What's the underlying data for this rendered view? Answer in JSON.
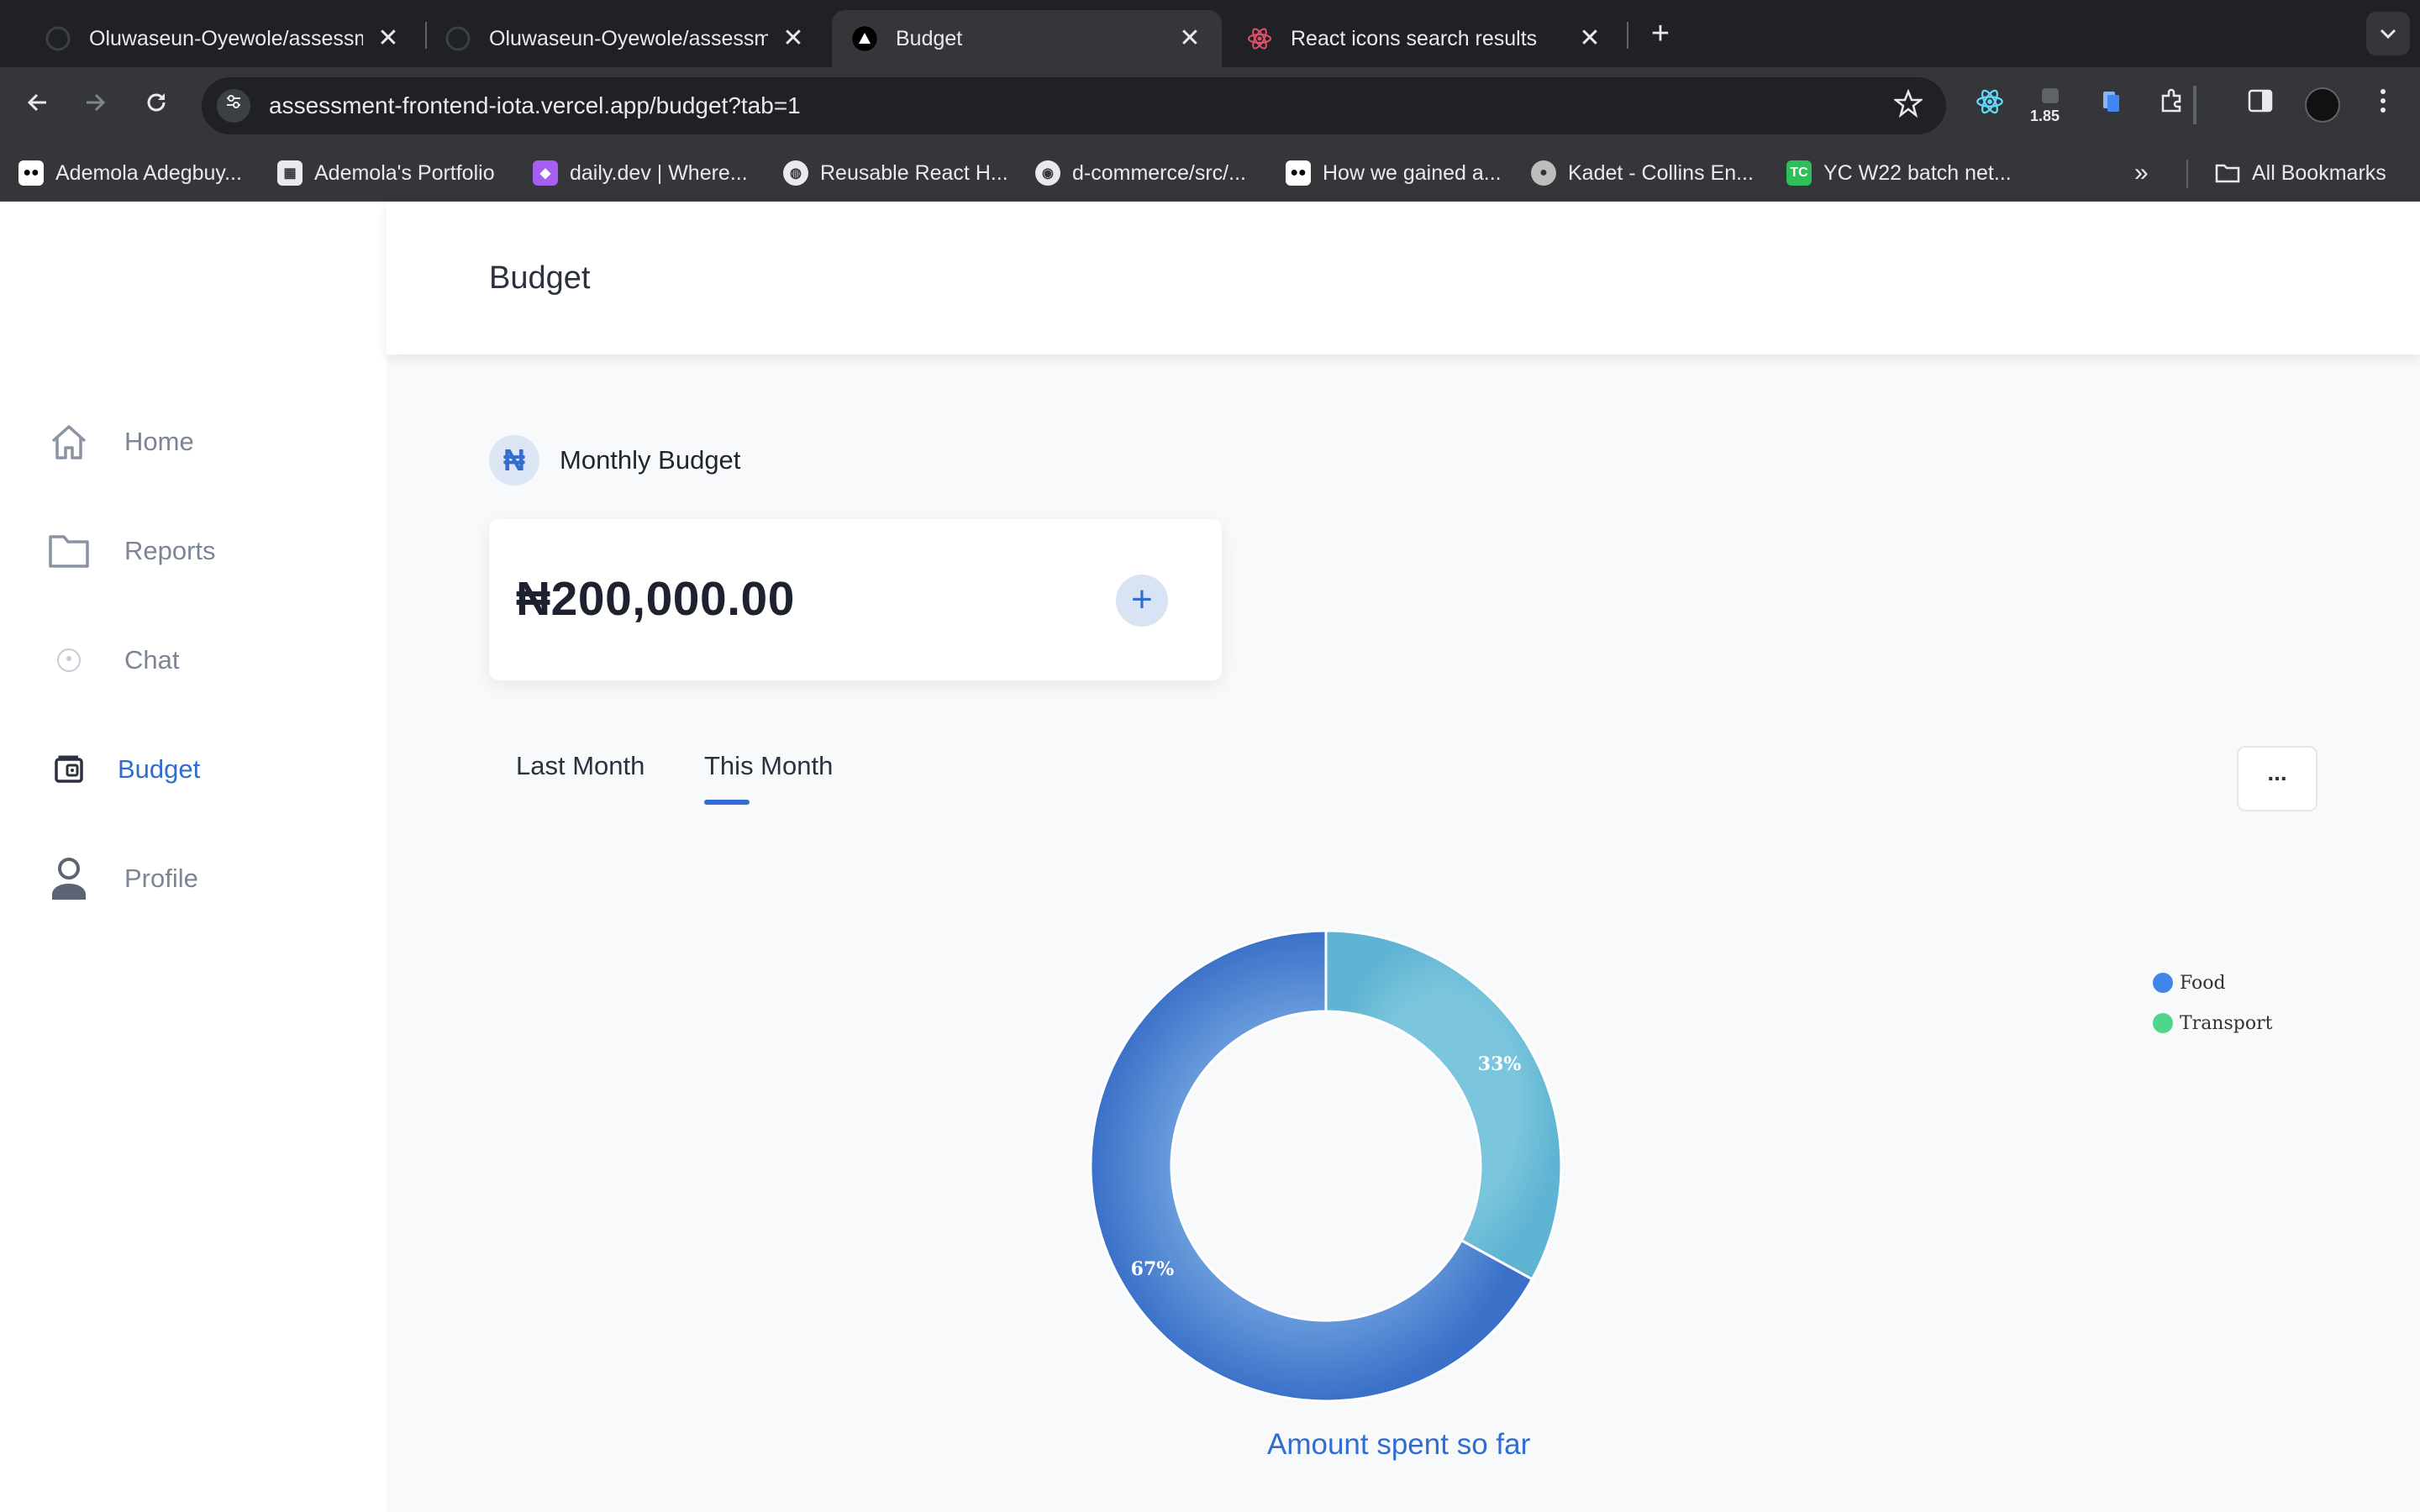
{
  "browser": {
    "tabs": [
      {
        "title": "Oluwaseun-Oyewole/assessment-frontend",
        "close": "✕"
      },
      {
        "title": "Oluwaseun-Oyewole/assessment-frontend",
        "close": "✕"
      },
      {
        "title": "Budget",
        "close": "✕"
      },
      {
        "title": "React icons search results",
        "close": "✕"
      }
    ],
    "new_tab": "+",
    "url_host": "assessment-frontend-iota.vercel.app",
    "url_path": "/budget?tab=1",
    "extension_badge": "1.85",
    "bookmarks": [
      "Ademola Adegbuy...",
      "Ademola's Portfolio",
      "daily.dev | Where...",
      "Reusable React H...",
      "d-commerce/src/...",
      "How we gained a...",
      "Kadet - Collins En...",
      "YC W22 batch net..."
    ],
    "bookmarks_more": "»",
    "all_bookmarks": "All Bookmarks"
  },
  "sidebar": {
    "items": [
      {
        "label": "Home",
        "icon": "home-icon"
      },
      {
        "label": "Reports",
        "icon": "folder-icon"
      },
      {
        "label": "Chat",
        "icon": "chat-icon"
      },
      {
        "label": "Budget",
        "icon": "wallet-icon"
      },
      {
        "label": "Profile",
        "icon": "user-icon"
      }
    ],
    "active": "Budget"
  },
  "header": {
    "title": "Budget"
  },
  "monthly_budget": {
    "currency_symbol": "₦",
    "label": "Monthly Budget",
    "amount": "₦200,000.00",
    "add_label": "+"
  },
  "period_tabs": {
    "items": [
      "Last Month",
      "This Month"
    ],
    "active": "This Month",
    "more_label": "..."
  },
  "colors": {
    "accent": "#2f6dd0",
    "food": "#3f86e8",
    "transport": "#4fd68a",
    "donut_food": "#5b8fd6",
    "donut_transport": "#6bbcd8"
  },
  "chart_data": {
    "type": "pie",
    "variant": "donut",
    "categories": [
      "Food",
      "Transport"
    ],
    "slice_order": [
      "Transport",
      "Food"
    ],
    "values": [
      67,
      33
    ],
    "data_labels": [
      "67%",
      "33%"
    ],
    "caption": "Amount spent so far",
    "legend_position": "top-right"
  }
}
